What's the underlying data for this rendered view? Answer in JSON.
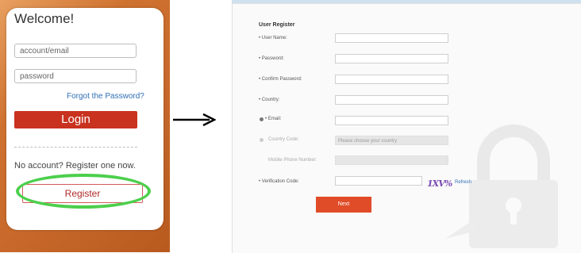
{
  "login": {
    "welcome": "Welcome!",
    "account_placeholder": "account/email",
    "password_placeholder": "password",
    "forgot_password": "Forgot the Password?",
    "login_button": "Login",
    "no_account_text": "No account? Register one now.",
    "register_button": "Register"
  },
  "register": {
    "title": "User Register",
    "labels": {
      "user_name": "• User Name:",
      "password": "• Password:",
      "confirm_password": "• Confirm Password:",
      "country": "• Country:",
      "email": "• Email:",
      "country_code": "Country Code:",
      "mobile_phone": "Mobile Phone Number:",
      "verification_code": "• Verification Code:"
    },
    "country_code_placeholder": "Please choose your country",
    "captcha_text": "1XV%",
    "refresh_link": "Refresh",
    "next_button": "Next"
  },
  "colors": {
    "login_button": "#c8321f",
    "next_button": "#e04c28",
    "highlight_ellipse": "#4ccf4c",
    "link": "#2f6fb6"
  },
  "icons": {
    "arrow": "right-arrow-icon",
    "padlock": "padlock-watermark-icon"
  }
}
